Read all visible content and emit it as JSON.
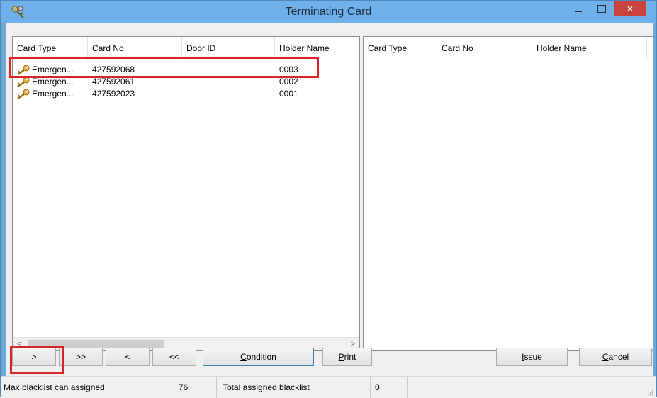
{
  "window": {
    "title": "Terminating Card",
    "close_glyph": "×"
  },
  "left_list": {
    "columns": [
      "Card Type",
      "Card No",
      "Door ID",
      "Holder Name"
    ],
    "rows": [
      {
        "card_type": "Emergen...",
        "card_no": "427592068",
        "door_id": "",
        "holder_name": "0003",
        "icon": "key-icon"
      },
      {
        "card_type": "Emergen...",
        "card_no": "427592061",
        "door_id": "",
        "holder_name": "0002",
        "icon": "key-icon"
      },
      {
        "card_type": "Emergen...",
        "card_no": "427592023",
        "door_id": "",
        "holder_name": "0001",
        "icon": "key-icon"
      }
    ],
    "scroll_left": "<",
    "scroll_right": ">"
  },
  "right_list": {
    "columns": [
      "Card Type",
      "Card No",
      "Holder Name"
    ],
    "rows": []
  },
  "buttons": {
    "move_one_right": ">",
    "move_all_right": ">>",
    "move_one_left": "<",
    "move_all_left": "<<",
    "condition_prefix": "C",
    "condition_rest": "ondition",
    "print_prefix": "P",
    "print_rest": "rint",
    "issue_prefix": "I",
    "issue_rest": "ssue",
    "cancel_prefix": "C",
    "cancel_rest": "ancel"
  },
  "status": {
    "max_label": "Max blacklist can assigned",
    "max_value": "76",
    "total_label": "Total assigned blacklist",
    "total_value": "0"
  },
  "colors": {
    "titlebar": "#6fb0ea",
    "highlight": "#d8232a",
    "close_button": "#c9423c"
  }
}
